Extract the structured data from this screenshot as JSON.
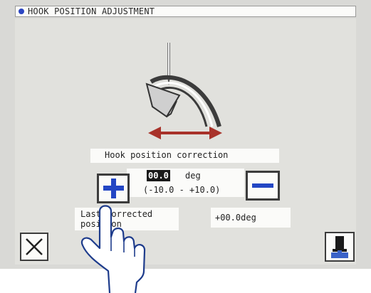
{
  "header": {
    "title": "HOOK POSITION ADJUSTMENT",
    "status_dot_color": "#2b45c2"
  },
  "adjustment": {
    "label": "Hook position correction",
    "value": "00.0",
    "unit": "deg",
    "range": "(-10.0 - +10.0)",
    "increment_icon": "plus-icon",
    "decrement_icon": "minus-icon"
  },
  "last_corrected": {
    "label": "Last corrected position",
    "value": "+00.0deg"
  },
  "footer": {
    "close_icon": "close-x-icon",
    "right_icon": "machine-io-icon"
  },
  "colors": {
    "bezel": "#d9d9d6",
    "panel": "#e1e1dd",
    "button_blue": "#2346c4",
    "arrow": "#a8322a",
    "hand_outline": "#1e3c8c"
  }
}
